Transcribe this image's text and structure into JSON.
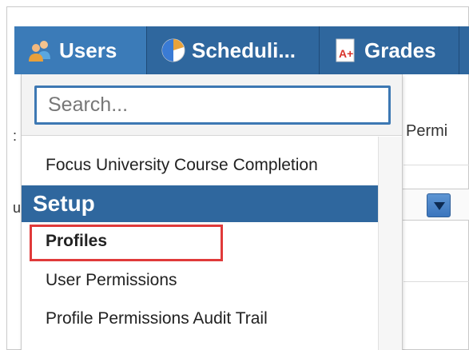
{
  "nav": {
    "tabs": [
      {
        "label": "Users",
        "icon": "users-icon",
        "active": true
      },
      {
        "label": "Scheduli...",
        "icon": "scheduling-icon",
        "active": false
      },
      {
        "label": "Grades",
        "icon": "grades-icon",
        "active": false
      }
    ]
  },
  "dropdown": {
    "search_placeholder": "Search...",
    "items_top": [
      {
        "label": "Focus University Course Completion"
      }
    ],
    "section_title": "Setup",
    "items": [
      {
        "label": "Profiles",
        "highlighted": true
      },
      {
        "label": "User Permissions"
      },
      {
        "label": "Profile Permissions Audit Trail"
      }
    ]
  },
  "background": {
    "column_label": "Permi"
  },
  "colors": {
    "nav_bg": "#2f679e",
    "section_bg": "#2f679e",
    "highlight_border": "#e03a3a",
    "search_border": "#3d78b3"
  }
}
